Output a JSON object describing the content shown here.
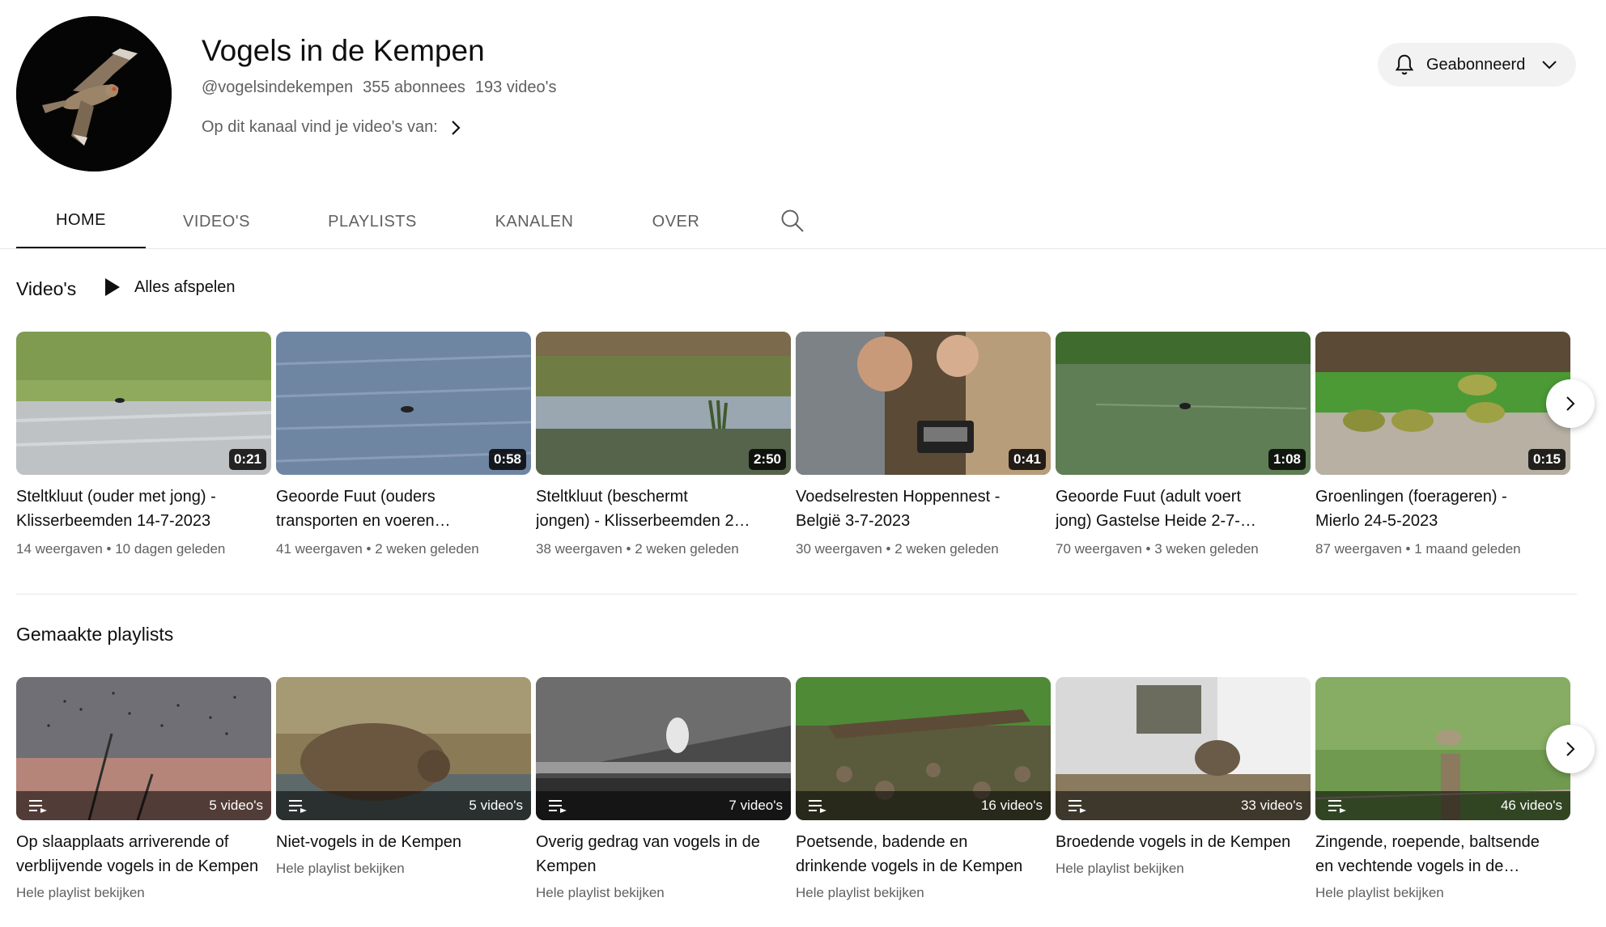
{
  "channel": {
    "title": "Vogels in de Kempen",
    "handle": "@vogelsindekempen",
    "subscribers": "355 abonnees",
    "video_count": "193 video's",
    "about": "Op dit kanaal vind je video's van:",
    "subscribe_label": "Geabonneerd"
  },
  "tabs": [
    {
      "label": "HOME",
      "active": true
    },
    {
      "label": "VIDEO'S",
      "active": false
    },
    {
      "label": "PLAYLISTS",
      "active": false
    },
    {
      "label": "KANALEN",
      "active": false
    },
    {
      "label": "OVER",
      "active": false
    }
  ],
  "videos_section": {
    "title": "Video's",
    "play_all": "Alles afspelen",
    "items": [
      {
        "title": "Steltkluut (ouder met jong) - Klisserbeemden 14-7-2023",
        "title_display": "Steltkluut (ouder met jong) -\nKlisserbeemden 14-7-2023",
        "duration": "0:21",
        "views": "14 weergaven",
        "age": "10 dagen geleden"
      },
      {
        "title": "Geoorde Fuut (ouders transporten en voeren…",
        "title_display": "Geoorde Fuut (ouders\ntransporten en voeren…",
        "duration": "0:58",
        "views": "41 weergaven",
        "age": "2 weken geleden"
      },
      {
        "title": "Steltkluut (beschermt jongen) - Klisserbeemden 2…",
        "title_display": "Steltkluut (beschermt\njongen) - Klisserbeemden 2…",
        "duration": "2:50",
        "views": "38 weergaven",
        "age": "2 weken geleden"
      },
      {
        "title": "Voedselresten Hoppennest - België 3-7-2023",
        "title_display": "Voedselresten Hoppennest -\nBelgië 3-7-2023",
        "duration": "0:41",
        "views": "30 weergaven",
        "age": "2 weken geleden"
      },
      {
        "title": "Geoorde Fuut (adult voert jong) Gastelse Heide 2-7-…",
        "title_display": "Geoorde Fuut (adult voert\njong) Gastelse Heide 2-7-…",
        "duration": "1:08",
        "views": "70 weergaven",
        "age": "3 weken geleden"
      },
      {
        "title": "Groenlingen (foerageren) - Mierlo 24-5-2023",
        "title_display": "Groenlingen (foerageren) -\nMierlo 24-5-2023",
        "duration": "0:15",
        "views": "87 weergaven",
        "age": "1 maand geleden"
      }
    ]
  },
  "playlists_section": {
    "title": "Gemaakte playlists",
    "view_label": "Hele playlist bekijken",
    "items": [
      {
        "title": "Op slaapplaats arriverende of verblijvende vogels in de Kempen",
        "title_display": "Op slaapplaats arriverende of\nverblijvende vogels in de Kempen",
        "count": "5 video's"
      },
      {
        "title": "Niet-vogels in de Kempen",
        "title_display": "Niet-vogels in de Kempen",
        "count": "5 video's"
      },
      {
        "title": "Overig gedrag van vogels in de Kempen",
        "title_display": "Overig gedrag van vogels in de\nKempen",
        "count": "7 video's"
      },
      {
        "title": "Poetsende, badende en drinkende vogels in de Kempen",
        "title_display": "Poetsende, badende en\ndrinkende vogels in de Kempen",
        "count": "16 video's"
      },
      {
        "title": "Broedende vogels in de Kempen",
        "title_display": "Broedende vogels in de Kempen",
        "count": "33 video's"
      },
      {
        "title": "Zingende, roepende, baltsende en vechtende vogels in de…",
        "title_display": "Zingende, roepende, baltsende\nen vechtende vogels in de…",
        "count": "46 video's"
      }
    ]
  },
  "colors": {
    "text": "#0f0f0f",
    "secondary": "#606060",
    "chip": "#f2f2f2"
  },
  "icons": [
    "bell-icon",
    "chevron-down-icon",
    "chevron-right-icon",
    "search-icon",
    "play-icon",
    "playlist-icon"
  ]
}
